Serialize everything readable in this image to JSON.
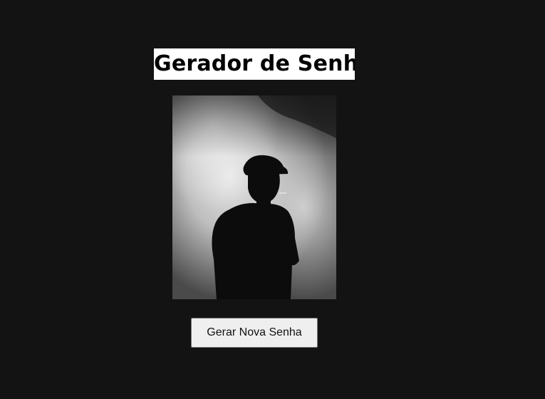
{
  "page": {
    "title": "Gerador de Senha",
    "generate_button_label": "Gerar Nova Senha"
  },
  "image": {
    "subject": "silhouette-man-flat-cap-smoke-photo"
  },
  "colors": {
    "background": "#131313",
    "title_background": "#ffffff",
    "title_text": "#000000",
    "button_background": "#efefef",
    "button_border": "#767676"
  }
}
